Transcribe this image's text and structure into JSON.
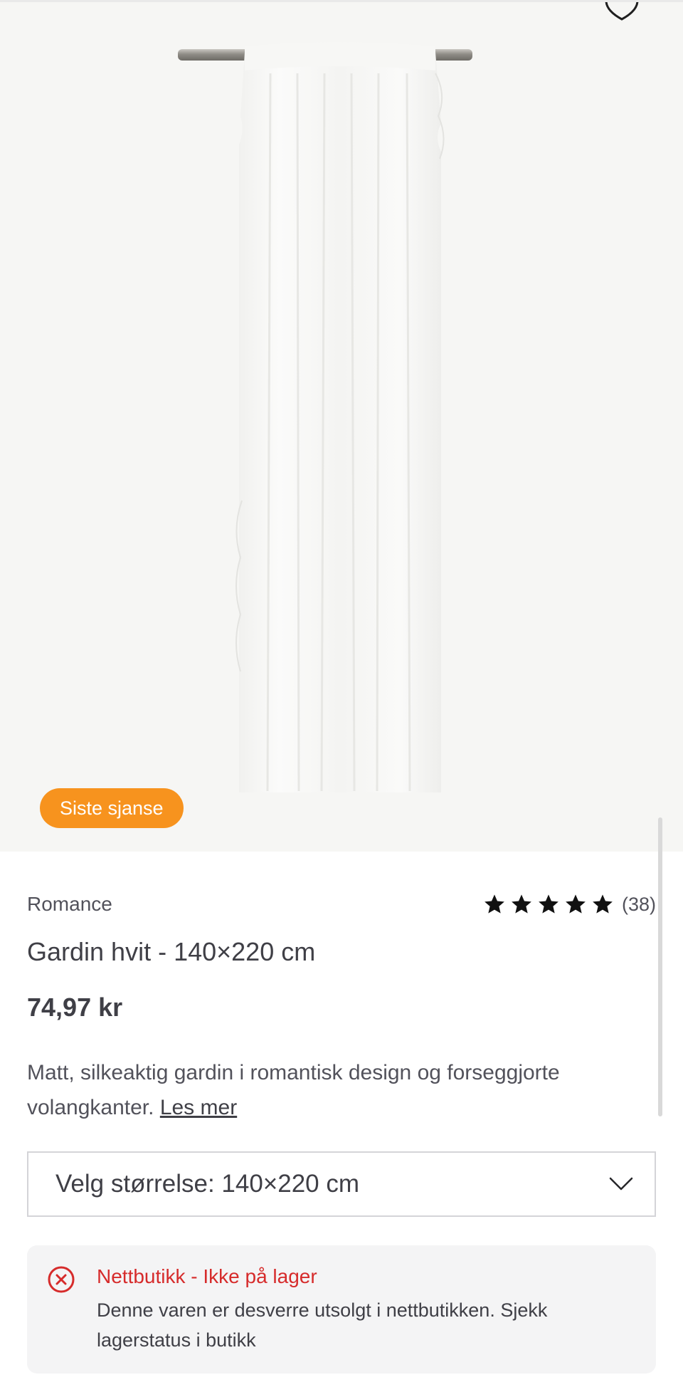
{
  "product": {
    "image_alt": "Gardin hvit",
    "badge": "Siste sjanse",
    "brand": "Romance",
    "title": "Gardin hvit - 140×220 cm",
    "price": "74,97 kr",
    "rating": {
      "stars": 5,
      "count": "(38)"
    },
    "description": "Matt, silkeaktig gardin i romantisk design og forseggjorte volangkanter.",
    "read_more": "Les mer"
  },
  "size_select": {
    "label": "Velg størrelse: 140×220 cm"
  },
  "stock": {
    "title": "Nettbutikk - Ikke på lager",
    "message": "Denne varen er desverre utsolgt i nettbutikken. Sjekk lagerstatus i butikk"
  },
  "colors": {
    "badge": "#f7931e",
    "error": "#d62b2b",
    "text": "#3f3f46",
    "hero_bg": "#f6f6f4"
  }
}
